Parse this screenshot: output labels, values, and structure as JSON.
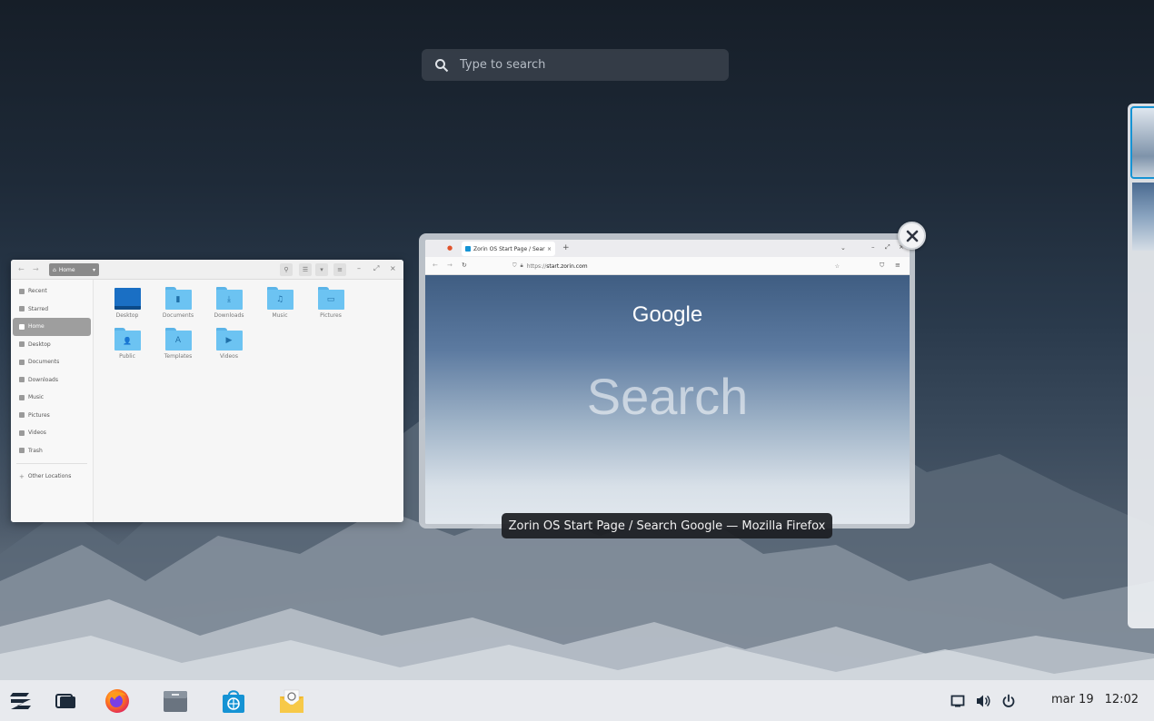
{
  "search": {
    "placeholder": "Type to search",
    "icon": "search-icon"
  },
  "files_window": {
    "path": "Home",
    "sidebar": [
      {
        "label": "Recent",
        "icon": "clock-icon"
      },
      {
        "label": "Starred",
        "icon": "star-icon"
      },
      {
        "label": "Home",
        "icon": "home-icon",
        "active": true
      },
      {
        "label": "Desktop",
        "icon": "desktop-icon"
      },
      {
        "label": "Documents",
        "icon": "document-icon"
      },
      {
        "label": "Downloads",
        "icon": "download-icon"
      },
      {
        "label": "Music",
        "icon": "music-icon"
      },
      {
        "label": "Pictures",
        "icon": "picture-icon"
      },
      {
        "label": "Videos",
        "icon": "video-icon"
      },
      {
        "label": "Trash",
        "icon": "trash-icon"
      },
      {
        "label": "Other Locations",
        "icon": "plus-icon"
      }
    ],
    "folders": [
      {
        "label": "Desktop",
        "glyph": ""
      },
      {
        "label": "Documents",
        "glyph": "▮"
      },
      {
        "label": "Downloads",
        "glyph": "⤓"
      },
      {
        "label": "Music",
        "glyph": "♫"
      },
      {
        "label": "Pictures",
        "glyph": "▭"
      },
      {
        "label": "Public",
        "glyph": "👤"
      },
      {
        "label": "Templates",
        "glyph": "A"
      },
      {
        "label": "Videos",
        "glyph": "▶"
      }
    ]
  },
  "firefox_window": {
    "tab_title": "Zorin OS Start Page / Sear",
    "url_prefix": "https://",
    "url_domain": "start.zorin.com",
    "logo": "Google",
    "search_text": "Search",
    "tooltip": "Zorin OS Start Page / Search Google — Mozilla Firefox"
  },
  "taskbar": {
    "apps": [
      {
        "name": "zorin-menu",
        "icon": "zorin-logo-icon"
      },
      {
        "name": "workspaces",
        "icon": "window-switcher-icon"
      },
      {
        "name": "firefox",
        "icon": "firefox-icon"
      },
      {
        "name": "files",
        "icon": "files-icon"
      },
      {
        "name": "software",
        "icon": "software-store-icon"
      },
      {
        "name": "mail",
        "icon": "mail-icon"
      }
    ],
    "date": "mar 19",
    "time": "12:02"
  },
  "colors": {
    "accent": "#1593d4",
    "folder": "#6cc3f2"
  }
}
